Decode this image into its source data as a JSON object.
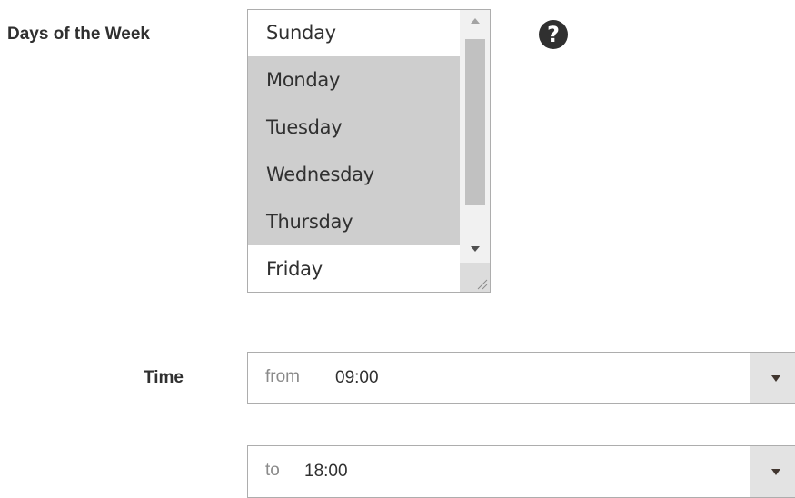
{
  "days_field": {
    "label": "Days of the Week",
    "options": [
      {
        "label": "Sunday",
        "selected": false
      },
      {
        "label": "Monday",
        "selected": true
      },
      {
        "label": "Tuesday",
        "selected": true
      },
      {
        "label": "Wednesday",
        "selected": true
      },
      {
        "label": "Thursday",
        "selected": true
      },
      {
        "label": "Friday",
        "selected": false
      }
    ],
    "help_icon": {
      "name": "question-circle-icon",
      "glyph": "?"
    }
  },
  "time_field": {
    "label": "Time",
    "from": {
      "prefix": "from",
      "value": "09:00"
    },
    "to": {
      "prefix": "to",
      "value": "18:00"
    }
  },
  "colors": {
    "selected_option_bg": "#cecece",
    "text": "#303030",
    "prefix_text": "#8a8a8a",
    "dropdown_button_bg": "#e3e3e3",
    "border": "#adadad"
  }
}
